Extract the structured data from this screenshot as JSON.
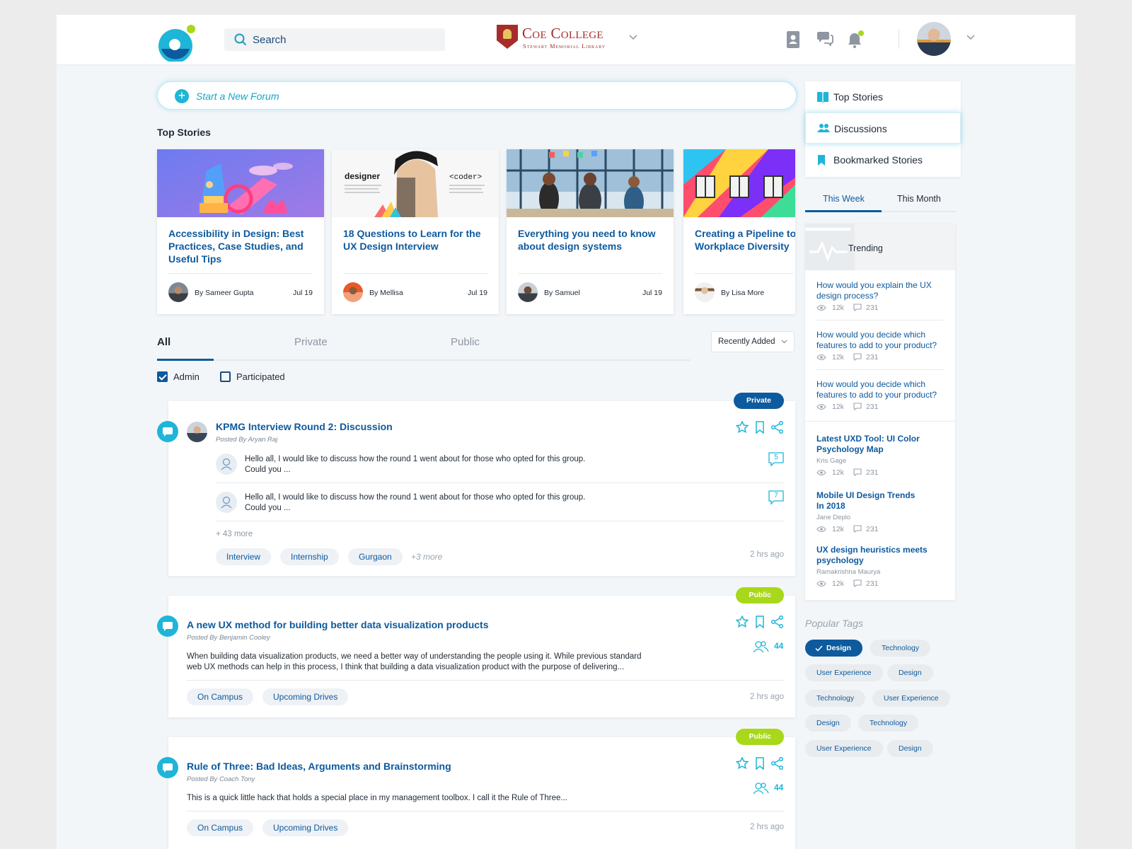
{
  "header": {
    "search_placeholder": "Search",
    "college_name": "Coe College",
    "college_sub": "Stewart Memorial Library"
  },
  "start_forum": "Start a New Forum",
  "top_stories_title": "Top Stories",
  "stories": [
    {
      "title": "Accessibility in Design: Best Practices, Case Studies, and Useful Tips",
      "author": "By Sameer Gupta",
      "date": "Jul 19"
    },
    {
      "title": "18 Questions to Learn for the UX Design Interview",
      "author": "By Mellisa",
      "date": "Jul 19",
      "img_text_left": "designer",
      "img_text_right": "<coder>"
    },
    {
      "title": "Everything you need to know about design systems",
      "author": "By Samuel",
      "date": "Jul 19"
    },
    {
      "title": "Creating a Pipeline to Workplace Diversity",
      "author": "By Lisa More",
      "date": ""
    }
  ],
  "tabs": [
    "All",
    "Private",
    "Public"
  ],
  "sort": "Recently Added",
  "filters": [
    {
      "label": "Admin",
      "checked": true
    },
    {
      "label": "Participated",
      "checked": false
    }
  ],
  "forums": [
    {
      "badge": "Private",
      "title": "KPMG Interview Round 2: Discussion",
      "posted_by": "Posted By Aryan Raj",
      "replies": [
        {
          "text1": "Hello all, I would like to discuss how the round 1 went about for those who opted for this group.",
          "text2": "Could you ...",
          "count": "5"
        },
        {
          "text1": "Hello all, I would like to discuss how the round 1 went about for those who opted for this group.",
          "text2": "Could you ...",
          "count": "7"
        }
      ],
      "more": "+ 43 more",
      "tags": [
        "Interview",
        "Internship",
        "Gurgaon"
      ],
      "tags_more": "+3 more",
      "time": "2 hrs ago"
    },
    {
      "badge": "Public",
      "title": "A new UX method for building better data visualization products",
      "posted_by": "Posted By Benjamin Cooley",
      "members": "44",
      "body1": "When building data visualization products, we need a better way of understanding the people using it. While previous standard",
      "body2": "web UX methods can help in this process, I think that building a data visualization product with the purpose of delivering...",
      "tags": [
        "On Campus",
        "Upcoming Drives"
      ],
      "time": "2 hrs ago"
    },
    {
      "badge": "Public",
      "title": "Rule of Three: Bad Ideas, Arguments and Brainstorming",
      "posted_by": "Posted By Coach Tony",
      "members": "44",
      "body1": "This is a quick little hack that holds a special place in my management toolbox. I call it the Rule of Three...",
      "tags": [
        "On Campus",
        "Upcoming Drives"
      ],
      "time": "2 hrs ago"
    }
  ],
  "right_nav": [
    {
      "label": "Top Stories",
      "icon": "book-icon"
    },
    {
      "label": "Discussions",
      "icon": "people-icon"
    },
    {
      "label": "Bookmarked Stories",
      "icon": "bookmark-icon"
    }
  ],
  "periods": [
    "This Week",
    "This Month"
  ],
  "trending": {
    "label": "Trending",
    "questions": [
      {
        "q": "How would you explain the UX design process?",
        "views": "12k",
        "comments": "231"
      },
      {
        "q": "How would you decide which features to add to your product?",
        "views": "12k",
        "comments": "231"
      },
      {
        "q": "How would you decide which features to add to your product?",
        "views": "12k",
        "comments": "231"
      }
    ],
    "articles": [
      {
        "title": "Latest UXD Tool: UI Color Psychology Map",
        "author": "Kris Gage",
        "views": "12k",
        "comments": "231"
      },
      {
        "title": "Mobile UI Design Trends In 2018",
        "author": "Jane Deplo",
        "views": "12k",
        "comments": "231"
      },
      {
        "title": "UX design heuristics meets psychology",
        "author": "Ramakrishna Maurya",
        "views": "12k",
        "comments": "231"
      }
    ]
  },
  "popular_tags": {
    "title": "Popular Tags",
    "tags": [
      {
        "label": "Design",
        "selected": true
      },
      {
        "label": "Technology"
      },
      {
        "label": "User Experience"
      },
      {
        "label": "Design"
      },
      {
        "label": "Technology"
      },
      {
        "label": "User Experience"
      },
      {
        "label": "Design"
      },
      {
        "label": "Technology"
      },
      {
        "label": "User Experience"
      },
      {
        "label": "Design"
      }
    ]
  },
  "colors": {
    "primary": "#0d5a9e",
    "accent": "#1fb5d8",
    "public": "#a8d81a"
  }
}
